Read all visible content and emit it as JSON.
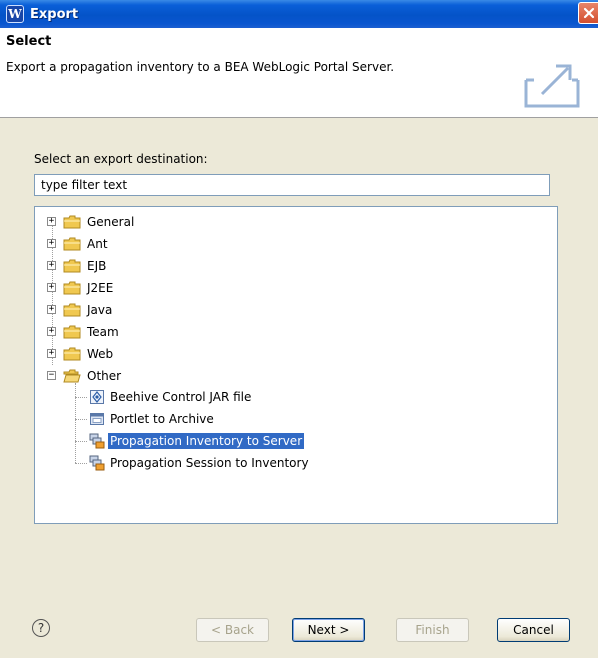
{
  "window": {
    "title": "Export",
    "app_icon_letter": "W"
  },
  "banner": {
    "title": "Select",
    "description": "Export a propagation inventory to a BEA WebLogic Portal Server."
  },
  "destination": {
    "label": "Select an export destination:",
    "filter_value": "type filter text"
  },
  "tree": {
    "folders": [
      {
        "label": "General",
        "expanded": false
      },
      {
        "label": "Ant",
        "expanded": false
      },
      {
        "label": "EJB",
        "expanded": false
      },
      {
        "label": "J2EE",
        "expanded": false
      },
      {
        "label": "Java",
        "expanded": false
      },
      {
        "label": "Team",
        "expanded": false
      },
      {
        "label": "Web",
        "expanded": false
      },
      {
        "label": "Other",
        "expanded": true
      }
    ],
    "other_children": [
      {
        "label": "Beehive Control JAR file",
        "icon": "beehive-jar-icon"
      },
      {
        "label": "Portlet to Archive",
        "icon": "portlet-archive-icon"
      },
      {
        "label": "Propagation Inventory to Server",
        "icon": "propagation-icon",
        "selected": true
      },
      {
        "label": "Propagation Session to Inventory",
        "icon": "propagation-icon"
      }
    ]
  },
  "buttons": {
    "back": "< Back",
    "next": "Next >",
    "finish": "Finish",
    "cancel": "Cancel"
  },
  "colors": {
    "titlebar": "#0453c8",
    "selection": "#316ac5",
    "folder": "#f0c850"
  }
}
